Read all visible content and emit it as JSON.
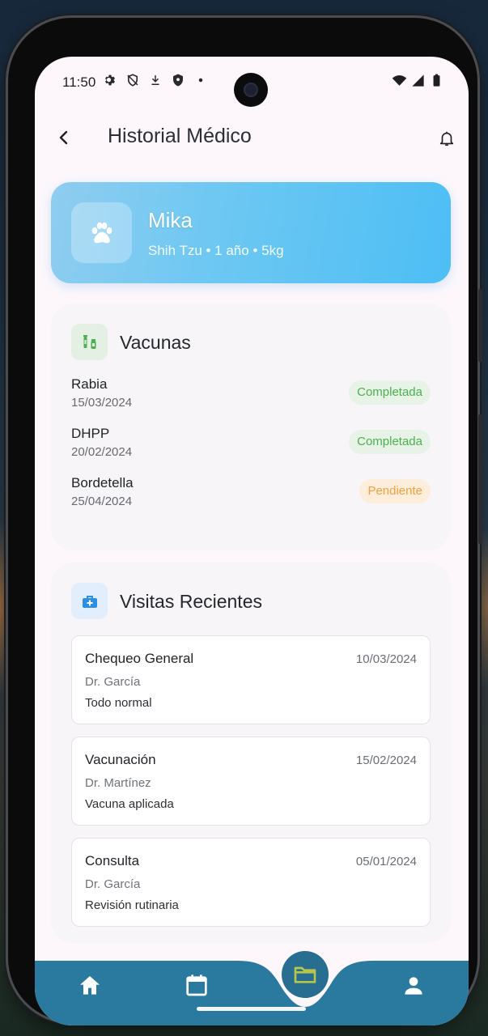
{
  "status_bar": {
    "time": "11:50"
  },
  "app_bar": {
    "title": "Historial Médico"
  },
  "pet": {
    "name": "Mika",
    "info": "Shih Tzu • 1 año • 5kg"
  },
  "vaccines": {
    "title": "Vacunas",
    "items": [
      {
        "name": "Rabia",
        "date": "15/03/2024",
        "status": "Completada"
      },
      {
        "name": "DHPP",
        "date": "20/02/2024",
        "status": "Completada"
      },
      {
        "name": "Bordetella",
        "date": "25/04/2024",
        "status": "Pendiente"
      }
    ]
  },
  "visits": {
    "title": "Visitas Recientes",
    "items": [
      {
        "type": "Chequeo General",
        "date": "10/03/2024",
        "doctor": "Dr. García",
        "note": "Todo normal"
      },
      {
        "type": "Vacunación",
        "date": "15/02/2024",
        "doctor": "Dr. Martínez",
        "note": "Vacuna aplicada"
      },
      {
        "type": "Consulta",
        "date": "05/01/2024",
        "doctor": "Dr. García",
        "note": "Revisión rutinaria"
      }
    ]
  },
  "bottom_nav": {
    "items": [
      {
        "icon": "home-icon"
      },
      {
        "icon": "calendar-icon"
      },
      {
        "icon": "folder-icon",
        "active": true
      },
      {
        "icon": "person-icon"
      }
    ]
  },
  "colors": {
    "nav": "#2a7aa0",
    "nav_fab": "#276e91",
    "pet_card": "#5ec4f4",
    "completed": "#4caf50",
    "pending": "#f0a040"
  }
}
